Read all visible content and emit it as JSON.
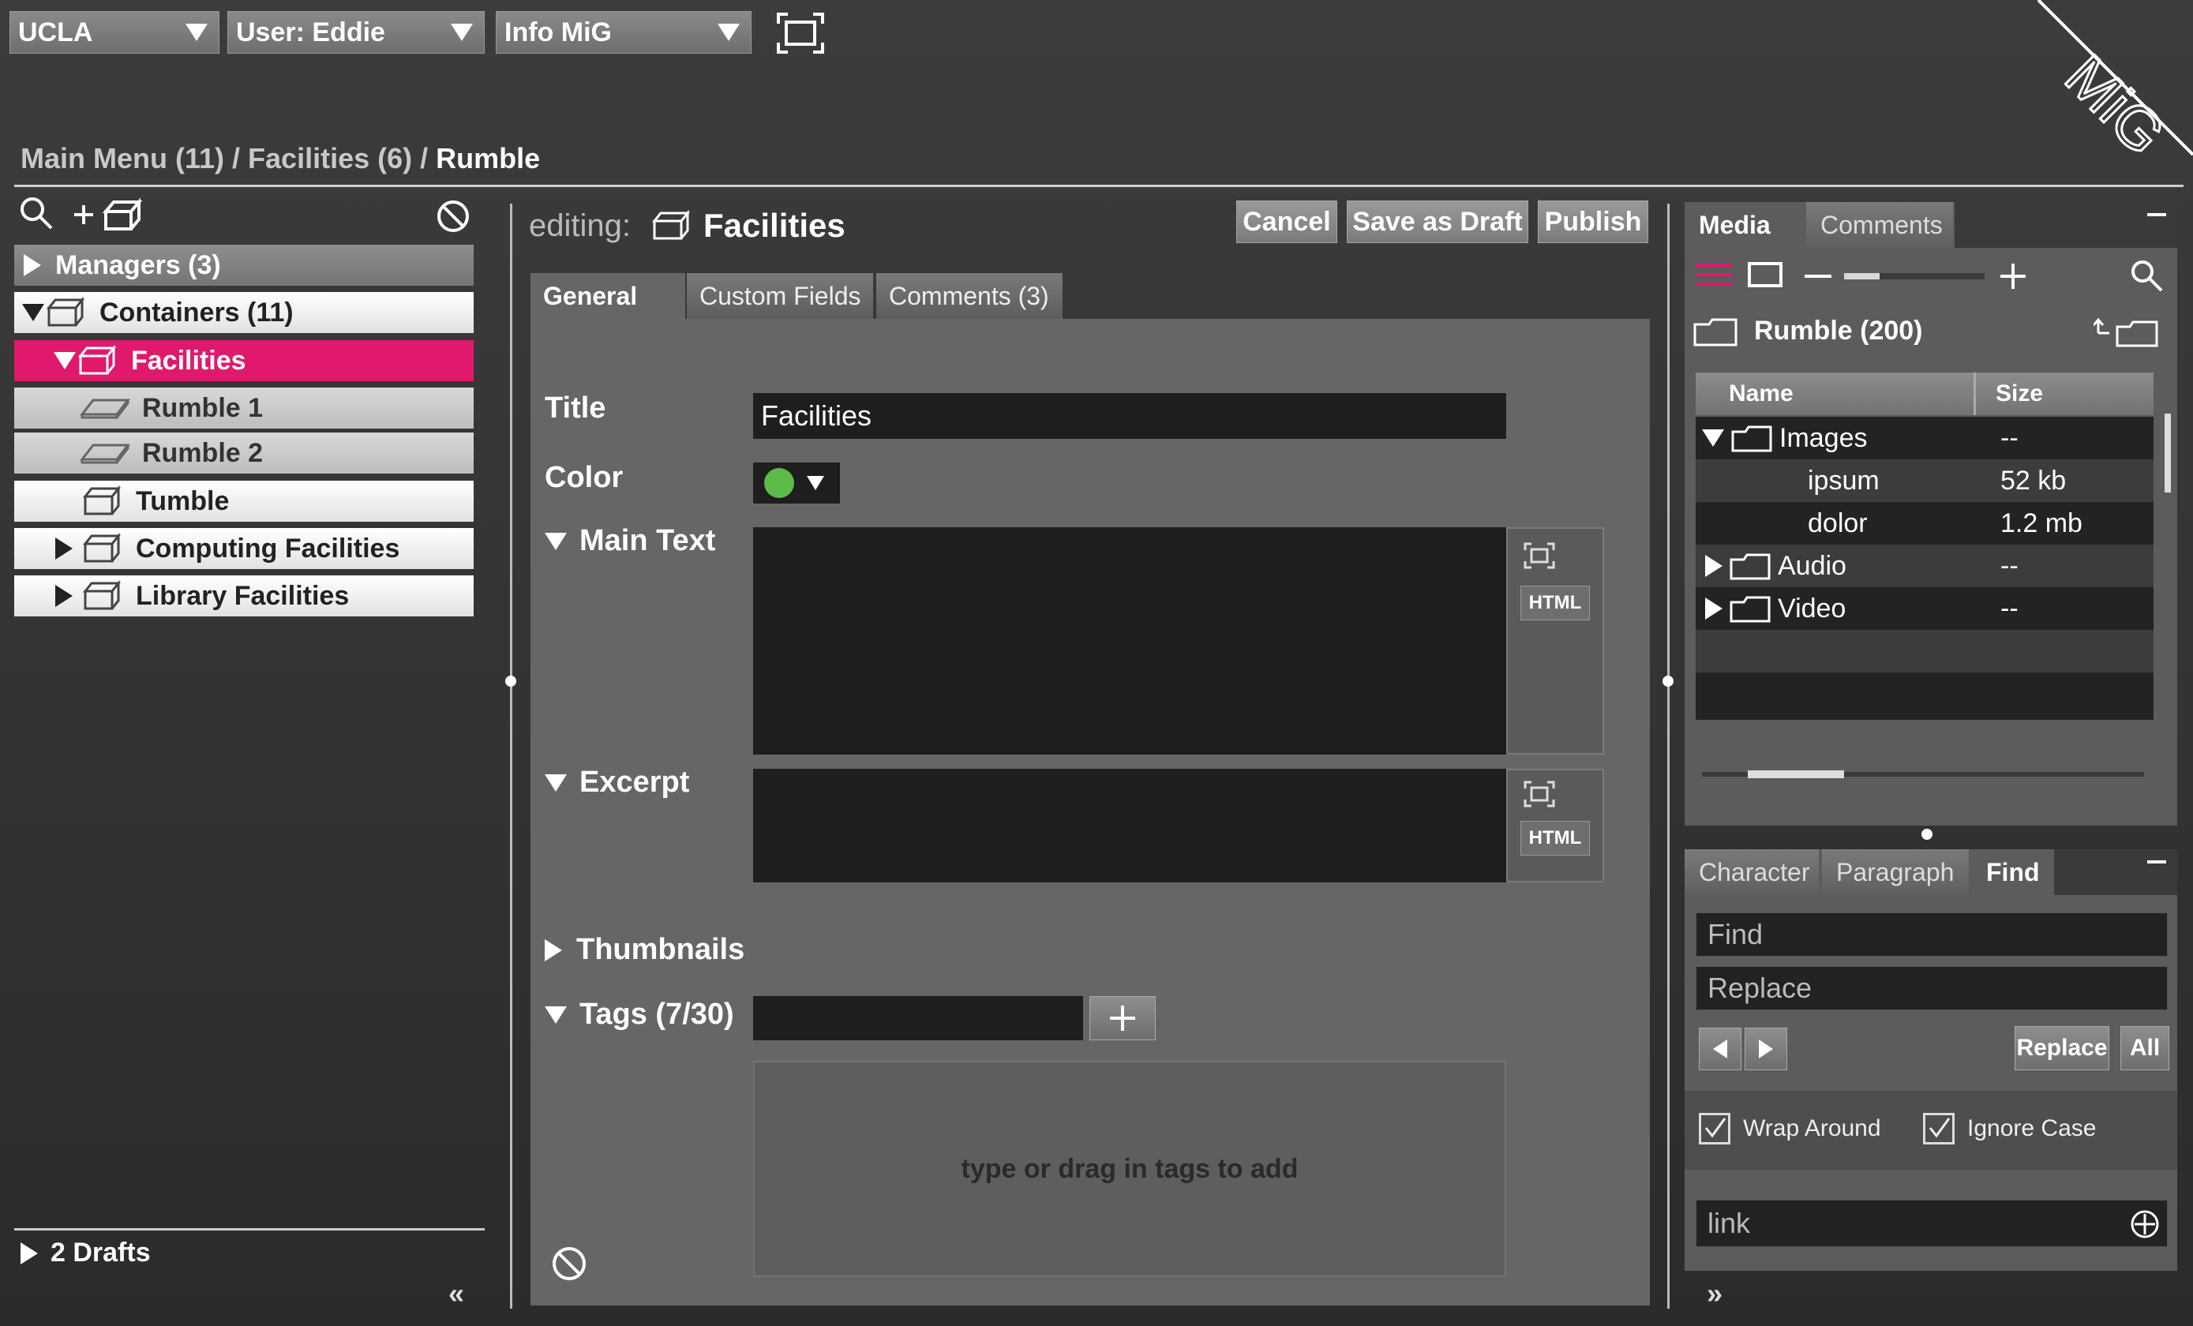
{
  "top": {
    "org": "UCLA",
    "user": "User: Eddie",
    "info": "Info MiG",
    "logo": "MiG"
  },
  "breadcrumb": {
    "main": "Main Menu (11)",
    "sep1": " / ",
    "facilities": "Facilities (6)",
    "sep2": " / ",
    "current": "Rumble"
  },
  "tree": {
    "items": [
      {
        "label": "Managers (3)"
      },
      {
        "label": "Containers (11)"
      },
      {
        "label": "Facilities"
      },
      {
        "label": "Rumble 1"
      },
      {
        "label": "Rumble 2"
      },
      {
        "label": "Tumble"
      },
      {
        "label": "Computing Facilities"
      },
      {
        "label": "Library Facilities"
      }
    ],
    "drafts": "2 Drafts",
    "collapse": "«"
  },
  "editor": {
    "editing_prefix": "editing:",
    "editing_title": "Facilities",
    "cancel": "Cancel",
    "save_draft": "Save as Draft",
    "publish": "Publish",
    "tabs": [
      "General",
      "Custom Fields",
      "Comments (3)"
    ],
    "title_label": "Title",
    "title_value": "Facilities",
    "color_label": "Color",
    "color_value": "#5dbb4a",
    "main_text_label": "Main Text",
    "excerpt_label": "Excerpt",
    "html_label": "HTML",
    "thumbnails_label": "Thumbnails",
    "tags_label": "Tags (7/30)",
    "tags_hint": "type or drag in tags to add"
  },
  "media": {
    "tabs": [
      "Media",
      "Comments"
    ],
    "folder": "Rumble (200)",
    "col_name": "Name",
    "col_size": "Size",
    "rows": [
      {
        "name": "Images",
        "size": "--"
      },
      {
        "name": "ipsum",
        "size": "52 kb"
      },
      {
        "name": "dolor",
        "size": "1.2 mb"
      },
      {
        "name": "Audio",
        "size": "--"
      },
      {
        "name": "Video",
        "size": "--"
      }
    ],
    "zoom_level": 0.25
  },
  "find": {
    "tabs": [
      "Character",
      "Paragraph",
      "Find"
    ],
    "find_placeholder": "Find",
    "replace_placeholder": "Replace",
    "replace_btn": "Replace",
    "all_btn": "All",
    "wrap_around": "Wrap Around",
    "ignore_case": "Ignore Case",
    "link_placeholder": "link",
    "expand": "»"
  },
  "colors": {
    "accent_pink": "#e0196c",
    "panel_gray": "#666666",
    "field_dark": "#1e1e1e"
  }
}
